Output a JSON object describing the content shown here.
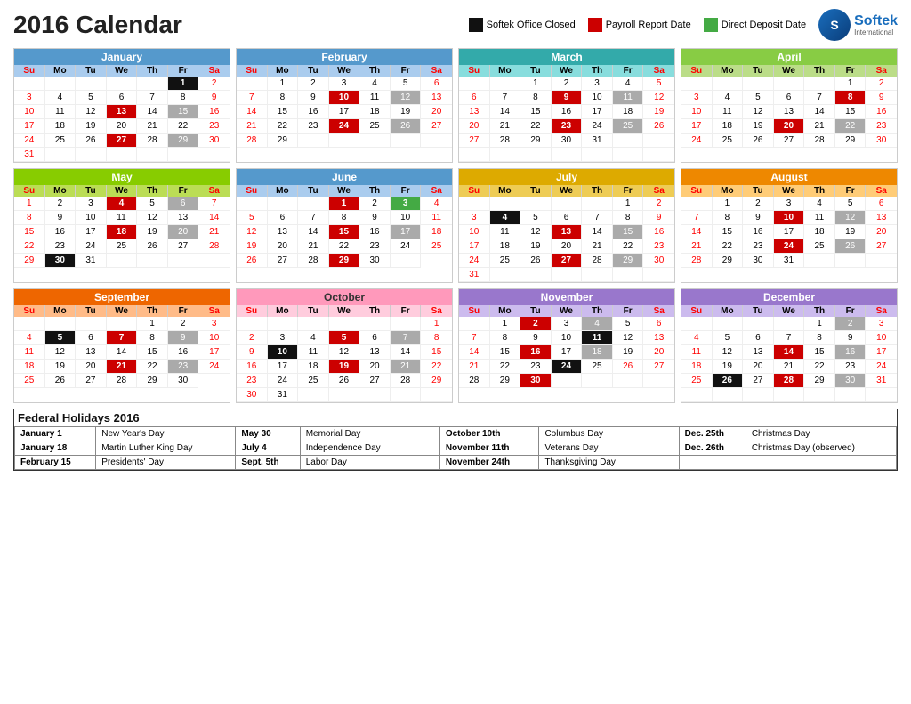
{
  "header": {
    "title": "2016 Calendar",
    "legend": [
      {
        "label": "Softek Office Closed",
        "color": "#111111"
      },
      {
        "label": "Payroll Report Date",
        "color": "#cc0000"
      },
      {
        "label": "Direct Deposit Date",
        "color": "#44aa44"
      }
    ],
    "logo_text": "Softek",
    "logo_sub": "International"
  },
  "holidays": {
    "title": "Federal Holidays 2016",
    "rows": [
      [
        {
          "date": "January 1",
          "name": "New Year's Day"
        },
        {
          "date": "May 30",
          "name": "Memorial Day"
        },
        {
          "date": "October 10th",
          "name": "Columbus Day"
        },
        {
          "date": "Dec. 25th",
          "name": "Christmas Day"
        }
      ],
      [
        {
          "date": "January 18",
          "name": "Martin Luther King Day"
        },
        {
          "date": "July 4",
          "name": "Independence Day"
        },
        {
          "date": "November 11th",
          "name": "Veterans Day"
        },
        {
          "date": "Dec. 26th",
          "name": "Christmas Day (observed)"
        }
      ],
      [
        {
          "date": "February 15",
          "name": "Presidents' Day"
        },
        {
          "date": "Sept. 5th",
          "name": "Labor Day"
        },
        {
          "date": "November 24th",
          "name": "Thanksgiving Day"
        },
        {
          "date": "",
          "name": ""
        }
      ]
    ]
  }
}
